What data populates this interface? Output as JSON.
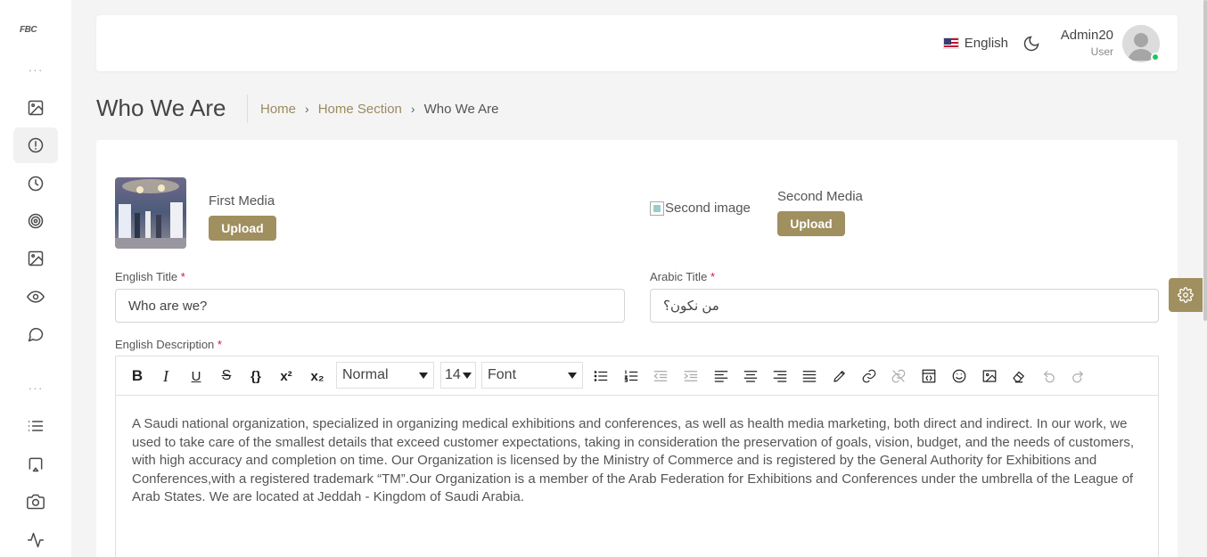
{
  "app": {
    "logo_text": "FBC"
  },
  "sidebar": {
    "items": [
      {
        "icon": "image-icon"
      },
      {
        "icon": "alert-circle-icon",
        "active": true
      },
      {
        "icon": "clock-icon"
      },
      {
        "icon": "target-icon"
      },
      {
        "icon": "image-icon"
      },
      {
        "icon": "eye-icon"
      },
      {
        "icon": "message-circle-icon"
      },
      {
        "icon": "list-icon"
      },
      {
        "icon": "cast-icon"
      },
      {
        "icon": "camera-icon"
      },
      {
        "icon": "activity-icon"
      }
    ]
  },
  "header": {
    "language": "English",
    "user_name": "Admin20",
    "user_role": "User"
  },
  "page": {
    "title": "Who We Are",
    "breadcrumb": [
      "Home",
      "Home Section",
      "Who We Are"
    ]
  },
  "media": {
    "first_label": "First Media",
    "second_label": "Second Media",
    "second_alt": "Second image",
    "upload_label": "Upload"
  },
  "form": {
    "english_title_label": "English Title",
    "english_title_value": "Who are we?",
    "arabic_title_label": "Arabic Title",
    "arabic_title_value": "من نكون؟",
    "required_mark": "*",
    "english_description_label": "English Description"
  },
  "editor": {
    "format_select": "Normal",
    "size_select": "14",
    "font_select": "Font",
    "content": " A Saudi national organization, specialized in organizing medical exhibitions and conferences, as well as health media marketing, both direct and indirect. In our work, we used to take care of the smallest details that exceed customer expectations, taking in consideration the preservation of goals, vision, budget, and the needs of customers, with high accuracy and completion on time. Our Organization is licensed by the Ministry of Commerce and is registered by the General Authority for Exhibitions and Conferences,with a registered trademark “TM”.Our Organization is a member of the Arab Federation for Exhibitions and Conferences under the umbrella of the League of Arab States. We are located at Jeddah - Kingdom of Saudi Arabia."
  },
  "colors": {
    "accent": "#a08f5f",
    "breadcrumb_link": "#9c8b5e",
    "online_status": "#22c55e"
  }
}
